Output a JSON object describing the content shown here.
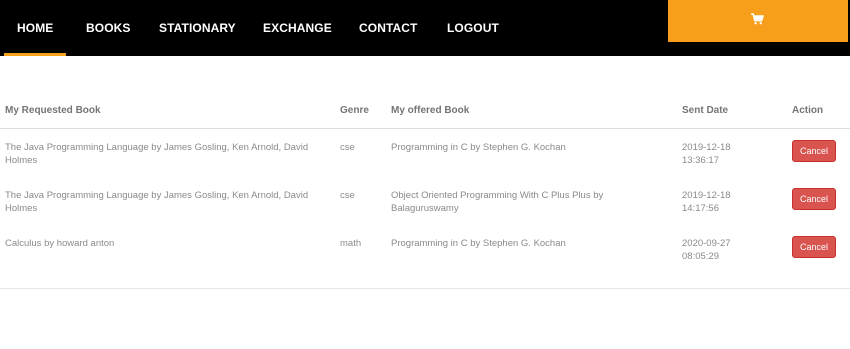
{
  "nav": {
    "items": [
      {
        "label": "HOME",
        "active": true
      },
      {
        "label": "BOOKS"
      },
      {
        "label": "STATIONARY"
      },
      {
        "label": "EXCHANGE"
      },
      {
        "label": "CONTACT"
      },
      {
        "label": "LOGOUT"
      }
    ],
    "cart_icon": "cart-icon",
    "accent_color": "#f79e1b"
  },
  "table": {
    "headers": [
      "My Requested Book",
      "Genre",
      "My offered Book",
      "Sent Date",
      "Action"
    ],
    "rows": [
      {
        "requested": "The Java Programming Language by James Gosling, Ken Arnold, David Holmes",
        "genre": "cse",
        "offered": "Programming in C by Stephen G. Kochan",
        "date": "2019-12-18",
        "time": "13:36:17",
        "action": "Cancel"
      },
      {
        "requested": "The Java Programming Language by James Gosling, Ken Arnold, David Holmes",
        "genre": "cse",
        "offered": "Object Oriented Programming With C Plus Plus by Balaguruswamy",
        "date": "2019-12-18",
        "time": "14:17:56",
        "action": "Cancel"
      },
      {
        "requested": "Calculus by howard anton",
        "genre": "math",
        "offered": "Programming in C by Stephen G. Kochan",
        "date": "2020-09-27",
        "time": "08:05:29",
        "action": "Cancel"
      }
    ],
    "cancel_color": "#d9534f"
  }
}
